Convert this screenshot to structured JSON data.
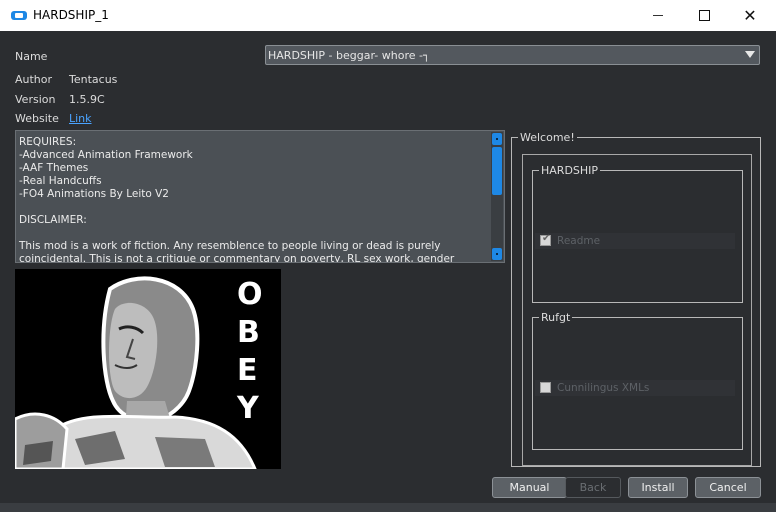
{
  "window": {
    "title": "HARDSHIP_1",
    "minimize_icon": "minimize-icon",
    "maximize_icon": "maximize-icon",
    "close_icon": "close-icon",
    "close_glyph": "✕"
  },
  "fields": {
    "name_label": "Name",
    "name_value": "HARDSHIP - beggar- whore -┐",
    "author_label": "Author",
    "author_value": "Tentacus",
    "version_label": "Version",
    "version_value": "1.5.9C",
    "website_label": "Website",
    "website_link": "Link"
  },
  "description": "REQUIRES:\n-Advanced Animation Framework\n-AAF Themes\n-Real Handcuffs\n-FO4 Animations By Leito V2\n\nDISCLAIMER:\n\nThis mod is a work of fiction. Any resemblence to people living or dead is purely coincidental. This is not a critique or commentary on poverty, RL sex work, gender issues, sexual orientation,",
  "image": {
    "letters": [
      "O",
      "B",
      "E",
      "Y"
    ]
  },
  "welcome": {
    "title": "Welcome!",
    "groups": [
      {
        "title": "HARDSHIP",
        "option": "Readme",
        "checked": true
      },
      {
        "title": "Rufgt",
        "option": "Cunnilingus XMLs",
        "checked": false
      }
    ]
  },
  "buttons": {
    "manual": "Manual",
    "back": "Back",
    "install": "Install",
    "cancel": "Cancel"
  },
  "colors": {
    "background": "#2b2d30",
    "accent": "#1e88e5",
    "link": "#4aa3ff"
  }
}
